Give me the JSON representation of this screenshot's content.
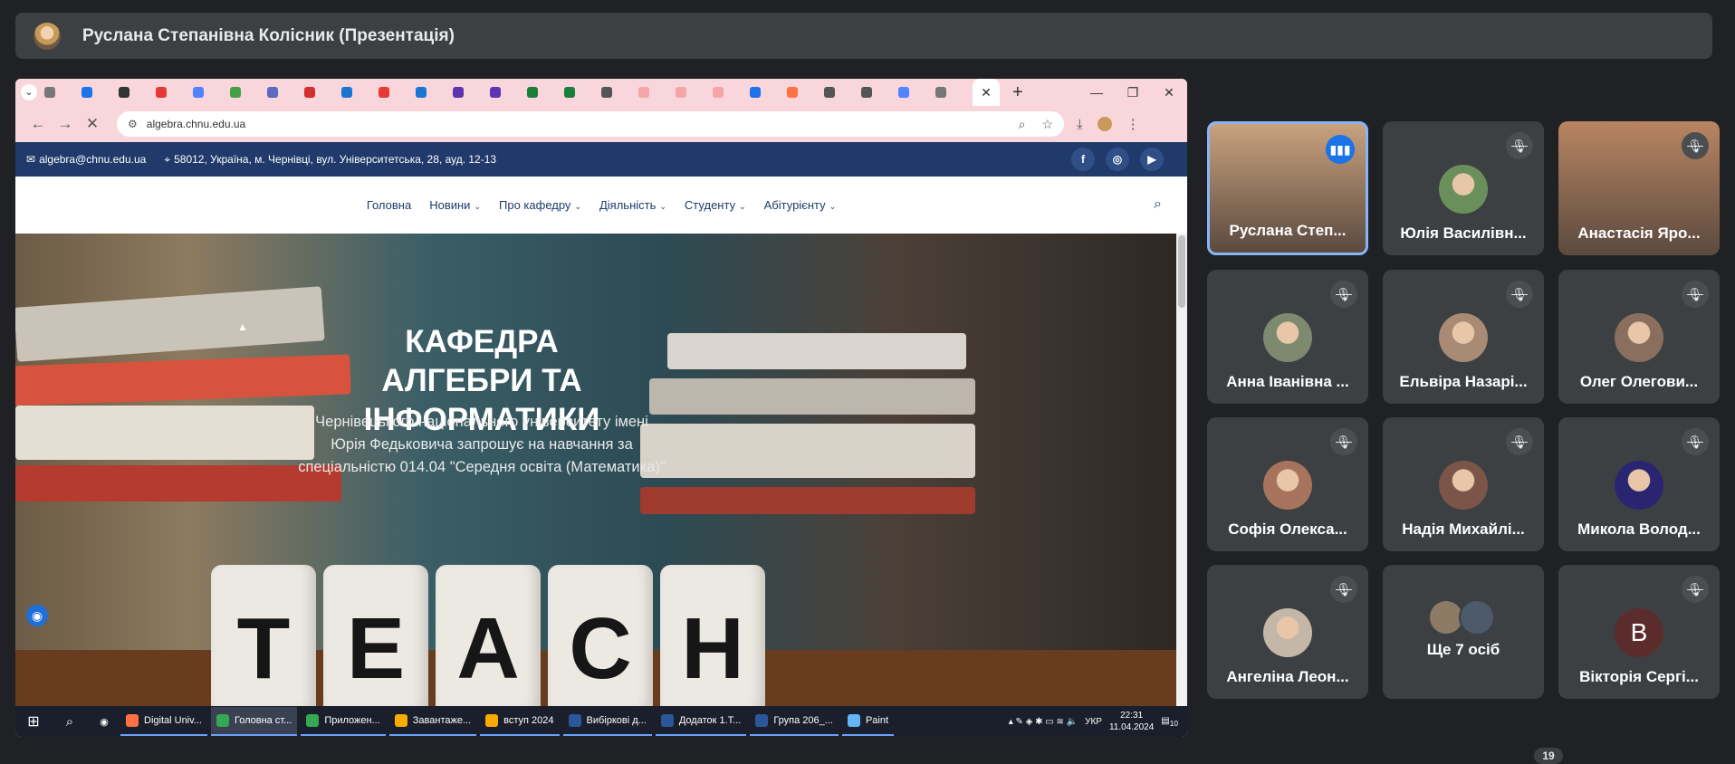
{
  "meeting": {
    "presenter_title": "Руслана Степанівна Колісник (Презентація)",
    "participant_badge": "19"
  },
  "browser": {
    "url": "algebra.chnu.edu.ua",
    "tab_colors": [
      "#777",
      "#1a73e8",
      "#333",
      "#e53935",
      "#4f83ff",
      "#43a047",
      "#5c6bc0",
      "#d32f2f",
      "#1976d2",
      "#e53935",
      "#1976d2",
      "#5e35b1",
      "#5e35b1",
      "#188038",
      "#188038",
      "#555",
      "#f4a6a6",
      "#f4a6a6",
      "#f4a6a6",
      "#1a73e8",
      "#ff7043",
      "#555",
      "#555",
      "#4f83ff",
      "#777"
    ]
  },
  "site": {
    "email": "algebra@chnu.edu.ua",
    "address": "58012, Україна, м. Чернівці, вул. Університетська, 28, ауд. 12-13",
    "social": [
      "f",
      "◎",
      "▶"
    ],
    "menu": [
      {
        "label": "Головна",
        "caret": ""
      },
      {
        "label": "Новини",
        "caret": "⌄"
      },
      {
        "label": "Про кафедру",
        "caret": "⌄"
      },
      {
        "label": "Діяльність",
        "caret": "⌄"
      },
      {
        "label": "Студенту",
        "caret": "⌄"
      },
      {
        "label": "Абітурієнту",
        "caret": "⌄"
      }
    ],
    "hero_title": "КАФЕДРА АЛГЕБРИ ТА ІНФОРМАТИКИ",
    "hero_subtitle": "Чернівецького національного університету імені Юрія Федьковича запрошує на навчання за спеціальністю 014.04 \"Середня освіта (Математика)\"",
    "dice": [
      "T",
      "E",
      "A",
      "C",
      "H"
    ]
  },
  "taskbar": {
    "items": [
      {
        "label": "Digital Univ...",
        "color": "#ff7043"
      },
      {
        "label": "Головна ст...",
        "color": "#34a853",
        "active": true
      },
      {
        "label": "Приложен...",
        "color": "#34a853"
      },
      {
        "label": "Завантаже...",
        "color": "#f9ab00"
      },
      {
        "label": "вступ 2024",
        "color": "#f9ab00"
      },
      {
        "label": "Вибіркові д...",
        "color": "#2b579a"
      },
      {
        "label": "Додаток 1.Т...",
        "color": "#2b579a"
      },
      {
        "label": "Група 206_...",
        "color": "#2b579a"
      },
      {
        "label": "Paint",
        "color": "#64b5f6"
      }
    ],
    "lang": "УКР",
    "time": "22:31",
    "date": "11.04.2024",
    "notif": "10"
  },
  "participants": [
    {
      "name": "Руслана Степ...",
      "speaking": true,
      "face": "#c9a27e"
    },
    {
      "name": "Юлія Василівн...",
      "face": "#6a8f5a"
    },
    {
      "name": "Анастасія Яро...",
      "face": "#b98562"
    },
    {
      "name": "Анна Іванівна ...",
      "face": "#7d8a6f"
    },
    {
      "name": "Ельвіра Назарі...",
      "face": "#a88a75"
    },
    {
      "name": "Олег Олегови...",
      "face": "#8a6f5e"
    },
    {
      "name": "Софія Олекса...",
      "face": "#a8735c"
    },
    {
      "name": "Надія Михайлі...",
      "face": "#7a5548"
    },
    {
      "name": "Микола Волод...",
      "face": "#2a2570"
    },
    {
      "name": "Ангеліна Леон...",
      "face": "#c5b7a8"
    },
    {
      "name": "Ще 7 осіб",
      "more": true
    },
    {
      "name": "Вікторія Сергі...",
      "letter": "В"
    }
  ]
}
